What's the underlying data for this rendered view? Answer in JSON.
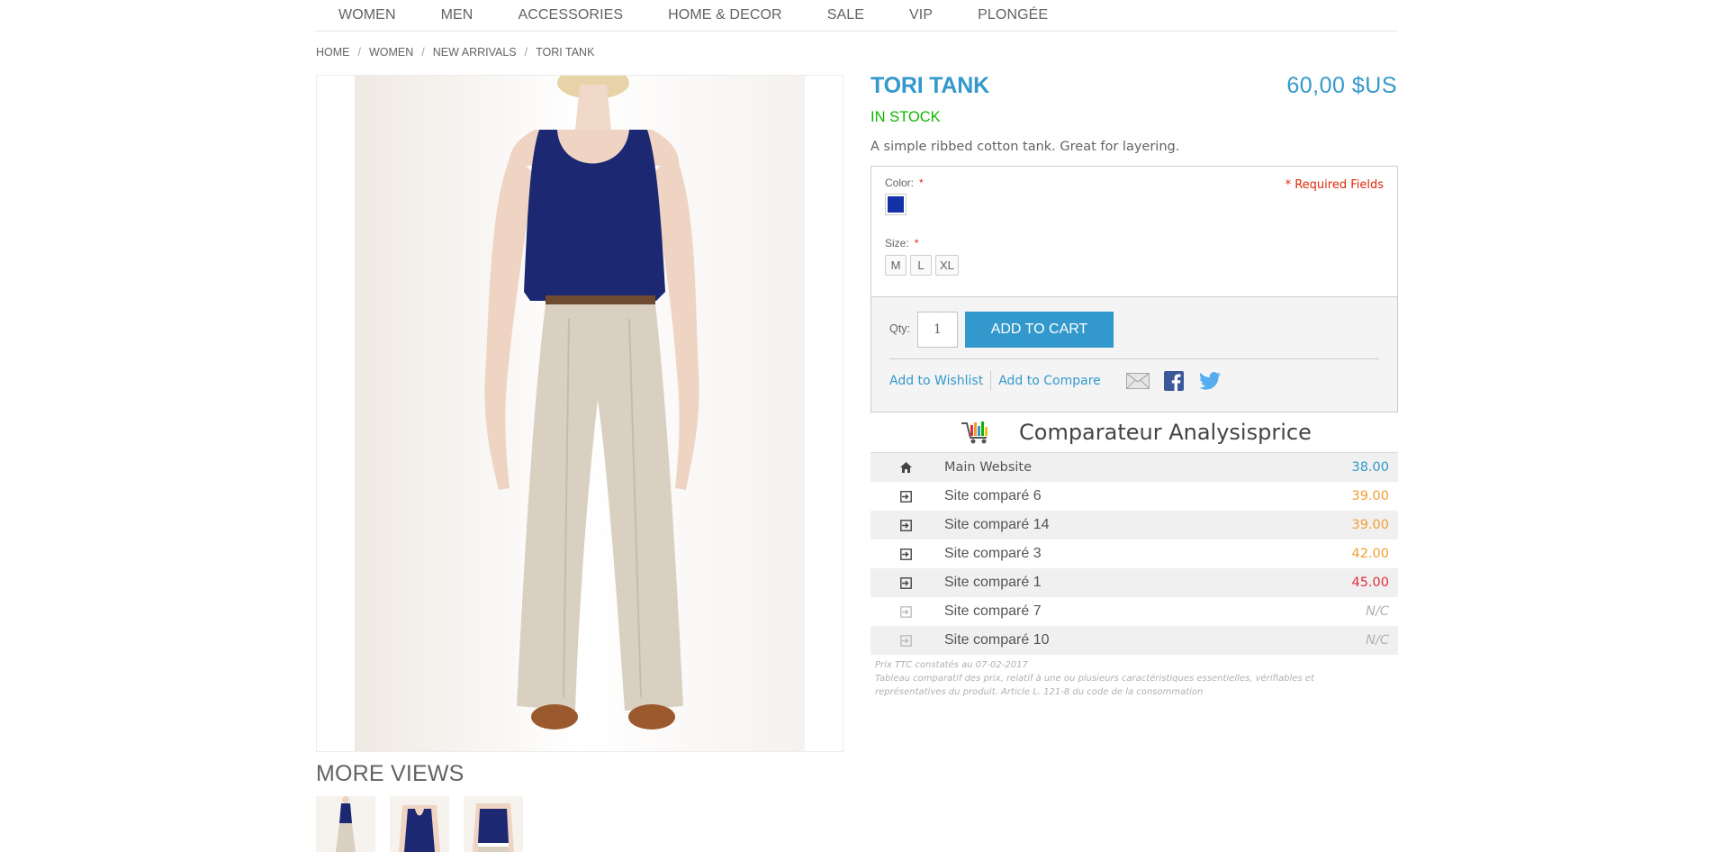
{
  "nav": {
    "items": [
      "WOMEN",
      "MEN",
      "ACCESSORIES",
      "HOME & DECOR",
      "SALE",
      "VIP",
      "PLONGÉE"
    ]
  },
  "breadcrumb": {
    "items": [
      "HOME",
      "WOMEN",
      "NEW ARRIVALS",
      "TORI TANK"
    ],
    "separator": "/"
  },
  "product": {
    "name": "TORI TANK",
    "price": "60,00 $US",
    "stock": "IN STOCK",
    "description": "A simple ribbed cotton tank. Great for layering."
  },
  "options": {
    "color_label": "Color:",
    "size_label": "Size:",
    "required_marker": "*",
    "required_note": "* Required Fields",
    "swatch_color": "#1431a6",
    "sizes": [
      "M",
      "L",
      "XL"
    ]
  },
  "cart": {
    "qty_label": "Qty:",
    "qty_value": "1",
    "add_to_cart": "ADD TO CART",
    "wishlist": "Add to Wishlist",
    "compare": "Add to Compare",
    "share_icons": [
      "email-icon",
      "facebook-icon",
      "twitter-icon"
    ]
  },
  "comparator": {
    "title": "Comparateur Analysisprice",
    "rows": [
      {
        "site": "Main Website",
        "price": "38.00",
        "color": "#3399cc",
        "icon": "home-icon"
      },
      {
        "site": "Site comparé 6",
        "price": "39.00",
        "color": "#f0a030",
        "icon": "external-site-icon"
      },
      {
        "site": "Site comparé 14",
        "price": "39.00",
        "color": "#f0a030",
        "icon": "external-site-icon"
      },
      {
        "site": "Site comparé 3",
        "price": "42.00",
        "color": "#f0a030",
        "icon": "external-site-icon"
      },
      {
        "site": "Site comparé 1",
        "price": "45.00",
        "color": "#e03040",
        "icon": "external-site-icon"
      },
      {
        "site": "Site comparé 7",
        "price": "N/C",
        "color": "#b0b0b0",
        "icon": "external-site-icon"
      },
      {
        "site": "Site comparé 10",
        "price": "N/C",
        "color": "#b0b0b0",
        "icon": "external-site-icon"
      }
    ],
    "note_line1": "Prix TTC constatés au 07-02-2017",
    "note_line2": "Tableau comparatif des prix, relatif à une ou plusieurs caractéristiques essentielles, vérifiables et représentatives du produit. Article L. 121-8 du code de la consommation"
  },
  "more_views": {
    "title": "MORE VIEWS",
    "thumb_count": 3
  },
  "colors": {
    "accent": "#3399cc",
    "stock_green": "#11b400",
    "required_red": "#df280a"
  }
}
